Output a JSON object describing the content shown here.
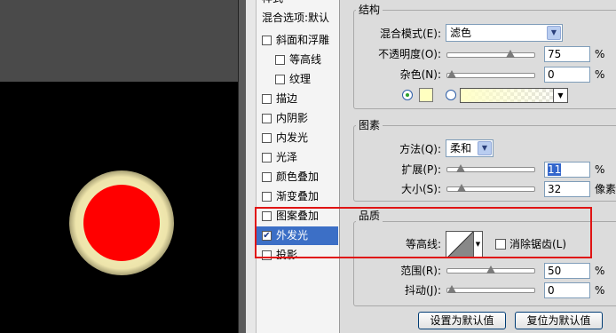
{
  "style_list": {
    "header_partial": "样式",
    "header": "混合选项:默认",
    "items": [
      {
        "label": "斜面和浮雕",
        "checked": false,
        "indent": false,
        "selected": false
      },
      {
        "label": "等高线",
        "checked": false,
        "indent": true,
        "selected": false
      },
      {
        "label": "纹理",
        "checked": false,
        "indent": true,
        "selected": false
      },
      {
        "label": "描边",
        "checked": false,
        "indent": false,
        "selected": false
      },
      {
        "label": "内阴影",
        "checked": false,
        "indent": false,
        "selected": false
      },
      {
        "label": "内发光",
        "checked": false,
        "indent": false,
        "selected": false
      },
      {
        "label": "光泽",
        "checked": false,
        "indent": false,
        "selected": false
      },
      {
        "label": "颜色叠加",
        "checked": false,
        "indent": false,
        "selected": false
      },
      {
        "label": "渐变叠加",
        "checked": false,
        "indent": false,
        "selected": false
      },
      {
        "label": "图案叠加",
        "checked": false,
        "indent": false,
        "selected": false
      },
      {
        "label": "外发光",
        "checked": true,
        "indent": false,
        "selected": true
      },
      {
        "label": "投影",
        "checked": false,
        "indent": false,
        "selected": false
      }
    ],
    "check_glyph": "✔"
  },
  "structure": {
    "title": "结构",
    "blend_label": "混合模式(E):",
    "blend_value": "滤色",
    "opacity_label": "不透明度(O):",
    "opacity_value": "75",
    "noise_label": "杂色(N):",
    "noise_value": "0",
    "percent": "%",
    "color": "#ffffc0"
  },
  "elements": {
    "title": "图素",
    "method_label": "方法(Q):",
    "method_value": "柔和",
    "spread_label": "扩展(P):",
    "spread_value": "11",
    "size_label": "大小(S):",
    "size_value": "32",
    "size_unit": "像素",
    "percent": "%"
  },
  "quality": {
    "title": "品质",
    "contour_label": "等高线:",
    "antialias_label": "消除锯齿(L)",
    "range_label": "范围(R):",
    "range_value": "50",
    "jitter_label": "抖动(J):",
    "jitter_value": "0",
    "percent": "%"
  },
  "buttons": {
    "make_default": "设置为默认值",
    "reset_default": "复位为默认值"
  },
  "icons": {
    "dropdown": "▼"
  },
  "sliders": {
    "opacity": 0.75,
    "noise": 0.0,
    "spread": 0.11,
    "size": 0.13,
    "range": 0.5,
    "jitter": 0.0
  },
  "colors": {
    "highlight": "#e01414",
    "selection": "#3c6fc6",
    "ball": "#ff0000"
  }
}
